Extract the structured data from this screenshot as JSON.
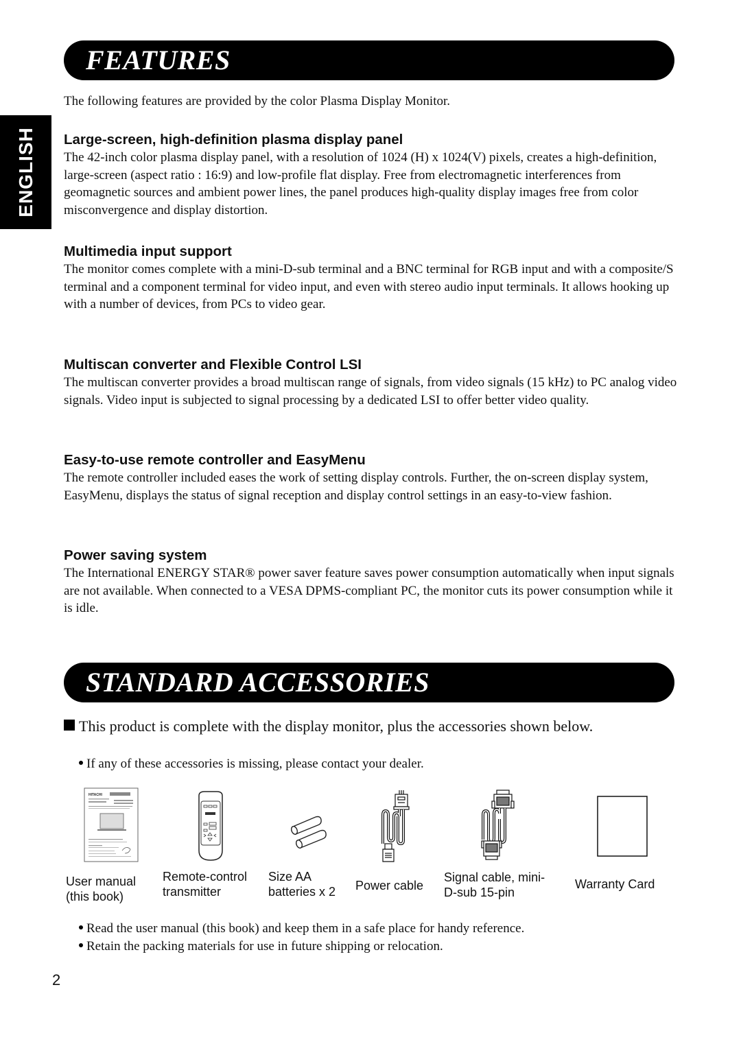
{
  "language_tab": "ENGLISH",
  "features": {
    "title": "FEATURES",
    "intro": "The following features are provided by the color Plasma Display Monitor.",
    "sections": [
      {
        "heading": "Large-screen, high-definition plasma display panel",
        "body": "The 42-inch color plasma display panel, with a resolution of 1024 (H) x 1024(V) pixels, creates a high-definition, large-screen (aspect ratio : 16:9) and low-profile flat display.  Free from electromagnetic interferences from geomagnetic sources and ambient power lines, the panel produces high-quality display images free from color misconvergence and display distortion."
      },
      {
        "heading": "Multimedia input support",
        "body": "The monitor comes complete with a mini-D-sub terminal and a BNC terminal for RGB input and with a composite/S terminal and a component terminal for video input, and even with stereo audio input terminals. It allows hooking up with a number of devices, from PCs to video gear."
      },
      {
        "heading": "Multiscan converter and Flexible Control LSI",
        "body": "The multiscan converter provides a broad multiscan range of signals, from video signals (15 kHz) to PC analog video signals.  Video input is subjected to signal processing by a dedicated LSI to offer better video quality."
      },
      {
        "heading": "Easy-to-use remote controller and EasyMenu",
        "body": "The remote controller included eases the work of setting display controls.  Further, the on-screen display system, EasyMenu, displays the status of signal reception and display control settings in an easy-to-view fashion."
      },
      {
        "heading": "Power saving system",
        "body": "The International ENERGY STAR® power saver feature saves power consumption automatically when input signals are not available.  When connected to a VESA DPMS-compliant PC, the monitor cuts its power consumption while it is idle."
      }
    ]
  },
  "accessories": {
    "title": "STANDARD ACCESSORIES",
    "lead": "This product is complete with the display monitor, plus the accessories shown below.",
    "note_missing": "If any of these accessories is missing, please contact your dealer.",
    "items": [
      {
        "icon": "user-manual-icon",
        "line1": "User manual",
        "line2": "(this book)"
      },
      {
        "icon": "remote-control-icon",
        "line1": "Remote-control",
        "line2": "transmitter"
      },
      {
        "icon": "batteries-icon",
        "line1": "Size AA",
        "line2": "batteries x 2"
      },
      {
        "icon": "power-cable-icon",
        "line1": "Power cable",
        "line2": ""
      },
      {
        "icon": "signal-cable-icon",
        "line1": "Signal cable, mini-",
        "line2": "D-sub 15-pin"
      },
      {
        "icon": "warranty-card-icon",
        "line1": "Warranty Card",
        "line2": ""
      }
    ],
    "manual_cover_brand": "HITACHI",
    "note_read": "Read the user manual (this book) and keep them in a safe place for handy reference.",
    "note_retain": "Retain the packing materials for use in future shipping or relocation."
  },
  "page_number": "2"
}
